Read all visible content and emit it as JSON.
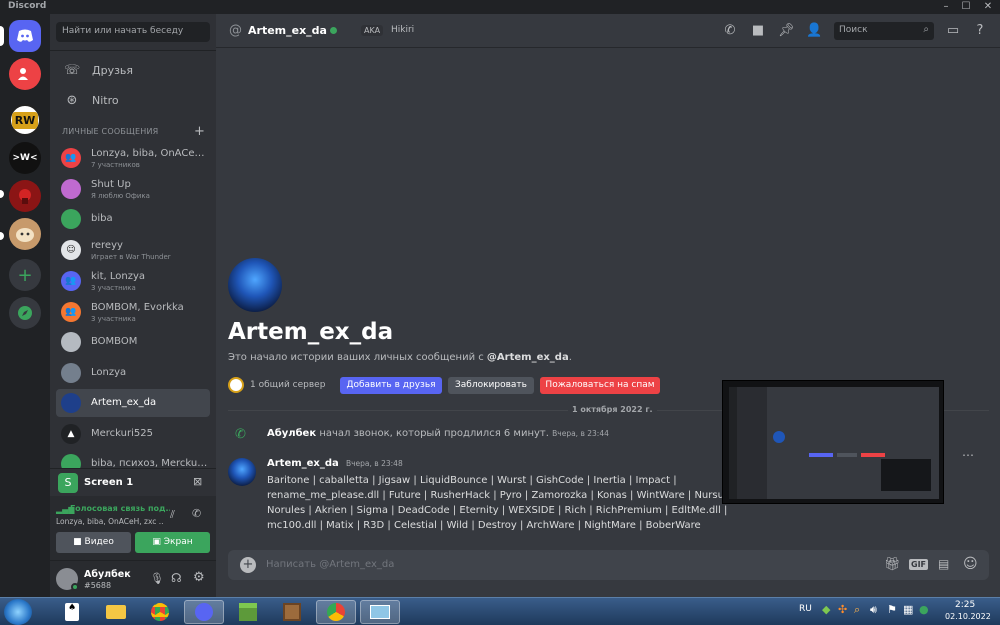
{
  "window": {
    "title": "Discord"
  },
  "sidebar": {
    "search_placeholder": "Найти или начать беседу",
    "friends_label": "Друзья",
    "nitro_label": "Nitro",
    "dm_header": "ЛИЧНЫЕ СООБЩЕНИЯ",
    "dms": [
      {
        "name": "Lonzya, biba, OnACeH...",
        "sub": "7 участников",
        "color": "#ed4245"
      },
      {
        "name": "Shut Up",
        "sub": "Я люблю Офика",
        "color": "#c06ad0"
      },
      {
        "name": "biba",
        "sub": "",
        "color": "#3ba55d"
      },
      {
        "name": "rereyy",
        "sub": "Играет в War Thunder",
        "color": "#e3e5e8"
      },
      {
        "name": "kit, Lonzya",
        "sub": "3 участника",
        "color": "#5865f2"
      },
      {
        "name": "BOMBOM, Evorkka",
        "sub": "3 участника",
        "color": "#f57731"
      },
      {
        "name": "BOMBOM",
        "sub": "",
        "color": "#b5bac1"
      },
      {
        "name": "Lonzya",
        "sub": "",
        "color": "#747f8d"
      },
      {
        "name": "Artem_ex_da",
        "sub": "",
        "color": "#1e3f8a"
      },
      {
        "name": "Merckuri525",
        "sub": "",
        "color": "#202225"
      },
      {
        "name": "biba, психоз, Merckuri...",
        "sub": "",
        "color": "#3ba55d"
      }
    ]
  },
  "screen_share": {
    "label": "Screen 1"
  },
  "voice": {
    "status": "Голосовая связь под...",
    "channel": "Lonzya, biba, OnACeH, zxc ...",
    "video_label": "Видео",
    "screen_label": "Экран"
  },
  "user": {
    "name": "Абулбек",
    "tag": "#5688"
  },
  "header": {
    "channel_name": "Artem_ex_da",
    "aka_label": "AKA",
    "aka_value": "Hikiri",
    "search_placeholder": "Поиск"
  },
  "profile": {
    "name": "Artem_ex_da",
    "intro_prefix": "Это начало истории ваших личных сообщений с ",
    "intro_mention": "@Artem_ex_da",
    "intro_suffix": ".",
    "mutual": "1 общий сервер",
    "add_friend": "Добавить в друзья",
    "block": "Заблокировать",
    "report": "Пожаловаться на спам"
  },
  "messages": {
    "date_divider": "1 октября 2022 г.",
    "call": {
      "author": "Абулбек",
      "text": "начал звонок, который продлился 6 минут.",
      "time": "Вчера, в 23:44"
    },
    "post": {
      "author": "Artem_ex_da",
      "time": "Вчера, в 23:48",
      "lines": [
        "Baritone | caballetta | Jigsaw | LiquidBounce | Wurst | GishCode | Inertia | Impact |",
        "rename_me_please.dll | Future | RusherHack | Pyro | Zamorozka | Konas | WintWare | Nursultan |",
        "Norules | Akrien | Sigma | DeadCode | Eternity | WEXSIDE | Rich | RichPremium | EdltMe.dll |",
        "mc100.dll | Matix | R3D | Celestial | Wild | Destroy | ArchWare | NightMare | BoberWare"
      ]
    }
  },
  "composer": {
    "placeholder": "Написать @Artem_ex_da"
  },
  "taskbar": {
    "lang": "RU",
    "time": "2:25",
    "date": "02.10.2022"
  },
  "colors": {
    "blurple": "#5865f2",
    "green": "#3ba55d",
    "red": "#ed4245",
    "gray_button": "#4f545c"
  }
}
